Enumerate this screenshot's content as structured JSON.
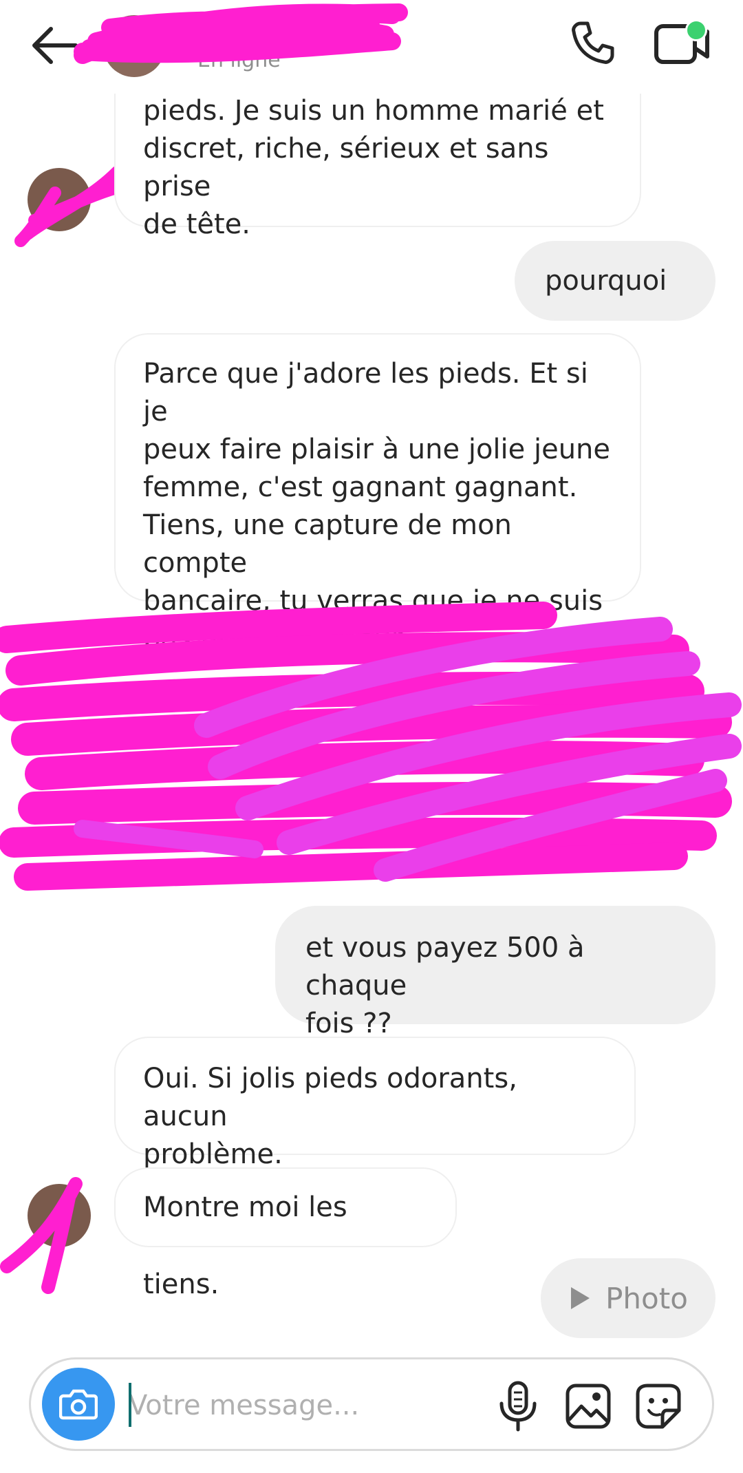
{
  "header": {
    "contact_name": "",
    "status": "En ligne"
  },
  "messages": [
    {
      "side": "in",
      "text": "pieds. Je suis un homme marié et\ndiscret, riche, sérieux et sans prise\nde tête."
    },
    {
      "side": "out",
      "text": "pourquoi ?"
    },
    {
      "side": "in",
      "text": "Parce que j'adore les pieds. Et si je\npeux faire plaisir à une jolie jeune\nfemme, c'est gagnant gagnant.\nTiens, une capture de mon compte\nbancaire, tu verras que je ne suis\npas un fantasmeur."
    },
    {
      "side": "out",
      "text": "et vous payez 500 à chaque\nfois ??"
    },
    {
      "side": "in",
      "text": "Oui. Si jolis pieds odorants, aucun\nproblème."
    },
    {
      "side": "in",
      "text": "Montre moi les tiens."
    }
  ],
  "photo_message": {
    "label": "Photo"
  },
  "composer": {
    "placeholder": "Votre message..."
  },
  "icons": {
    "back": "back-arrow-icon",
    "call": "phone-icon",
    "video": "video-camera-icon",
    "camera": "camera-icon",
    "mic": "microphone-icon",
    "gallery": "gallery-icon",
    "sticker": "sticker-icon",
    "play": "play-icon"
  },
  "colors": {
    "accent": "#3797f0",
    "online": "#3bd16f",
    "redaction": "#ff1fd0",
    "outgoing_bubble": "#efefef"
  }
}
